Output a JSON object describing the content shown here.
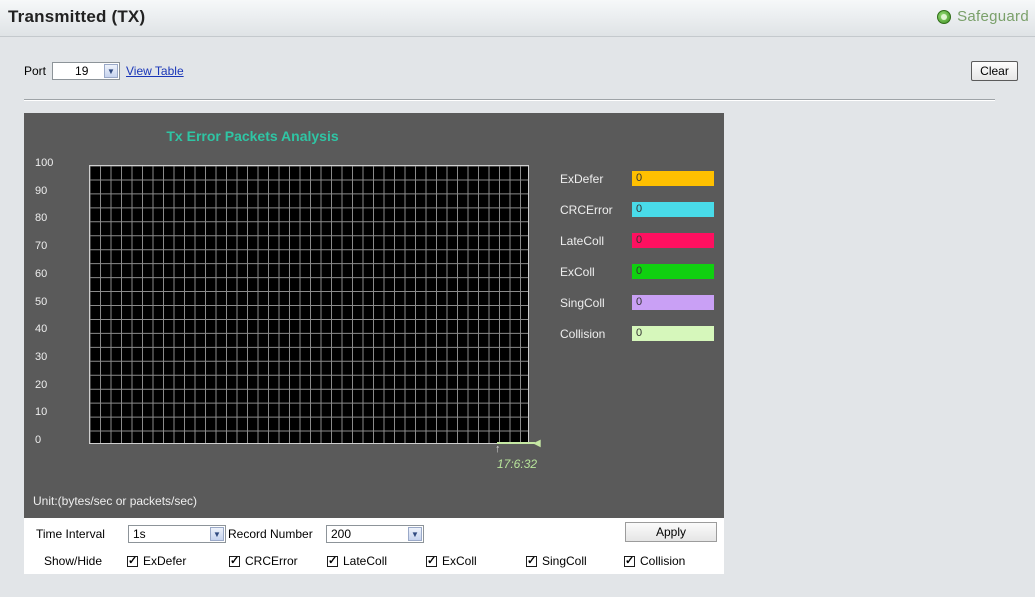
{
  "header": {
    "title": "Transmitted (TX)",
    "brand": "Safeguard"
  },
  "toolbar": {
    "port_label": "Port",
    "port_value": "19",
    "view_table": "View Table",
    "clear_label": "Clear"
  },
  "chart_data": {
    "type": "line",
    "title": "Tx Error Packets Analysis",
    "ylim": [
      0,
      100
    ],
    "y_ticks": [
      "100",
      "90",
      "80",
      "70",
      "60",
      "50",
      "40",
      "30",
      "20",
      "10",
      "0"
    ],
    "x_tick": "17:6:32",
    "grid": true,
    "series": [
      {
        "name": "ExDefer",
        "value": 0,
        "color": "#ffc000"
      },
      {
        "name": "CRCError",
        "value": 0,
        "color": "#49dbe9"
      },
      {
        "name": "LateColl",
        "value": 0,
        "color": "#ff1060"
      },
      {
        "name": "ExColl",
        "value": 0,
        "color": "#10d010"
      },
      {
        "name": "SingColl",
        "value": 0,
        "color": "#c9a0f5"
      },
      {
        "name": "Collision",
        "value": 0,
        "color": "#d6f7bb"
      }
    ],
    "unit": "Unit:(bytes/sec or packets/sec)"
  },
  "controls": {
    "time_interval_label": "Time Interval",
    "time_interval_value": "1s",
    "record_number_label": "Record Number",
    "record_number_value": "200",
    "apply_label": "Apply",
    "show_hide_label": "Show/Hide",
    "checkboxes": [
      {
        "label": "ExDefer",
        "checked": true
      },
      {
        "label": "CRCError",
        "checked": true
      },
      {
        "label": "LateColl",
        "checked": true
      },
      {
        "label": "ExColl",
        "checked": true
      },
      {
        "label": "SingColl",
        "checked": true
      },
      {
        "label": "Collision",
        "checked": true
      }
    ]
  }
}
